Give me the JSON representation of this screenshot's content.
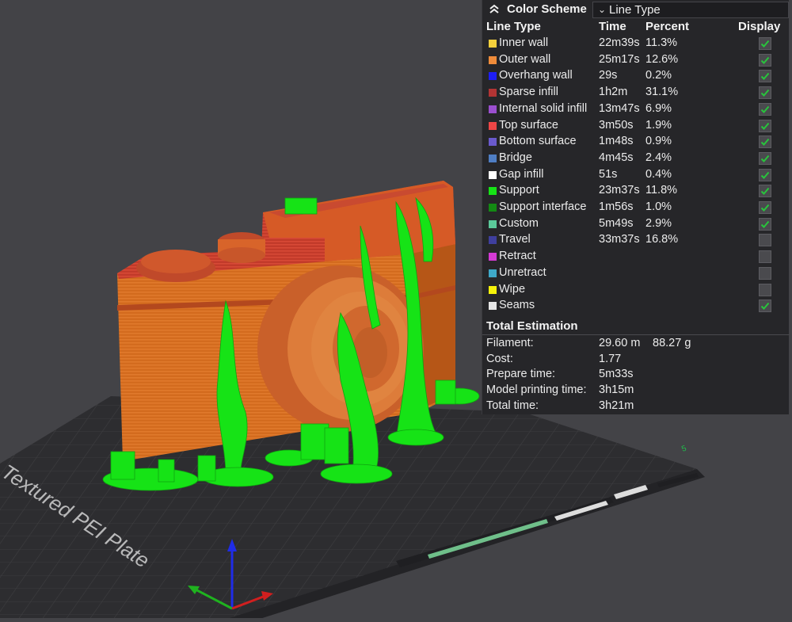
{
  "scene": {
    "plate_label": "Textured PEI Plate"
  },
  "panel": {
    "title": "Color Scheme",
    "scheme_value": "Line Type",
    "headers": {
      "type": "Line Type",
      "time": "Time",
      "percent": "Percent",
      "display": "Display"
    },
    "rows": [
      {
        "name": "Inner wall",
        "time": "22m39s",
        "percent": "11.3%",
        "color": "#f5d03c",
        "checked": true
      },
      {
        "name": "Outer wall",
        "time": "25m17s",
        "percent": "12.6%",
        "color": "#f08c3a",
        "checked": true
      },
      {
        "name": "Overhang wall",
        "time": "29s",
        "percent": "0.2%",
        "color": "#1e1ef5",
        "checked": true
      },
      {
        "name": "Sparse infill",
        "time": "1h2m",
        "percent": "31.1%",
        "color": "#b23434",
        "checked": true
      },
      {
        "name": "Internal solid infill",
        "time": "13m47s",
        "percent": "6.9%",
        "color": "#9b4fcf",
        "checked": true
      },
      {
        "name": "Top surface",
        "time": "3m50s",
        "percent": "1.9%",
        "color": "#ee4646",
        "checked": true
      },
      {
        "name": "Bottom surface",
        "time": "1m48s",
        "percent": "0.9%",
        "color": "#6a5acd",
        "checked": true
      },
      {
        "name": "Bridge",
        "time": "4m45s",
        "percent": "2.4%",
        "color": "#4f7ec4",
        "checked": true
      },
      {
        "name": "Gap infill",
        "time": "51s",
        "percent": "0.4%",
        "color": "#ffffff",
        "checked": true
      },
      {
        "name": "Support",
        "time": "23m37s",
        "percent": "11.8%",
        "color": "#16e316",
        "checked": true
      },
      {
        "name": "Support interface",
        "time": "1m56s",
        "percent": "1.0%",
        "color": "#138a13",
        "checked": true
      },
      {
        "name": "Custom",
        "time": "5m49s",
        "percent": "2.9%",
        "color": "#5bc99a",
        "checked": true
      },
      {
        "name": "Travel",
        "time": "33m37s",
        "percent": "16.8%",
        "color": "#3f3f9e",
        "checked": false
      },
      {
        "name": "Retract",
        "time": "",
        "percent": "",
        "color": "#d43ad4",
        "checked": false
      },
      {
        "name": "Unretract",
        "time": "",
        "percent": "",
        "color": "#3fa9c9",
        "checked": false
      },
      {
        "name": "Wipe",
        "time": "",
        "percent": "",
        "color": "#f5f20a",
        "checked": false
      },
      {
        "name": "Seams",
        "time": "",
        "percent": "",
        "color": "#e6e6e6",
        "checked": true
      }
    ],
    "total_title": "Total Estimation",
    "estimation": [
      {
        "label": "Filament:",
        "value": "29.60 m",
        "value2": "88.27 g"
      },
      {
        "label": "Cost:",
        "value": "1.77",
        "value2": ""
      },
      {
        "label": "Prepare time:",
        "value": "5m33s",
        "value2": ""
      },
      {
        "label": "Model printing time:",
        "value": "3h15m",
        "value2": ""
      },
      {
        "label": "Total time:",
        "value": "3h21m",
        "value2": ""
      }
    ]
  }
}
